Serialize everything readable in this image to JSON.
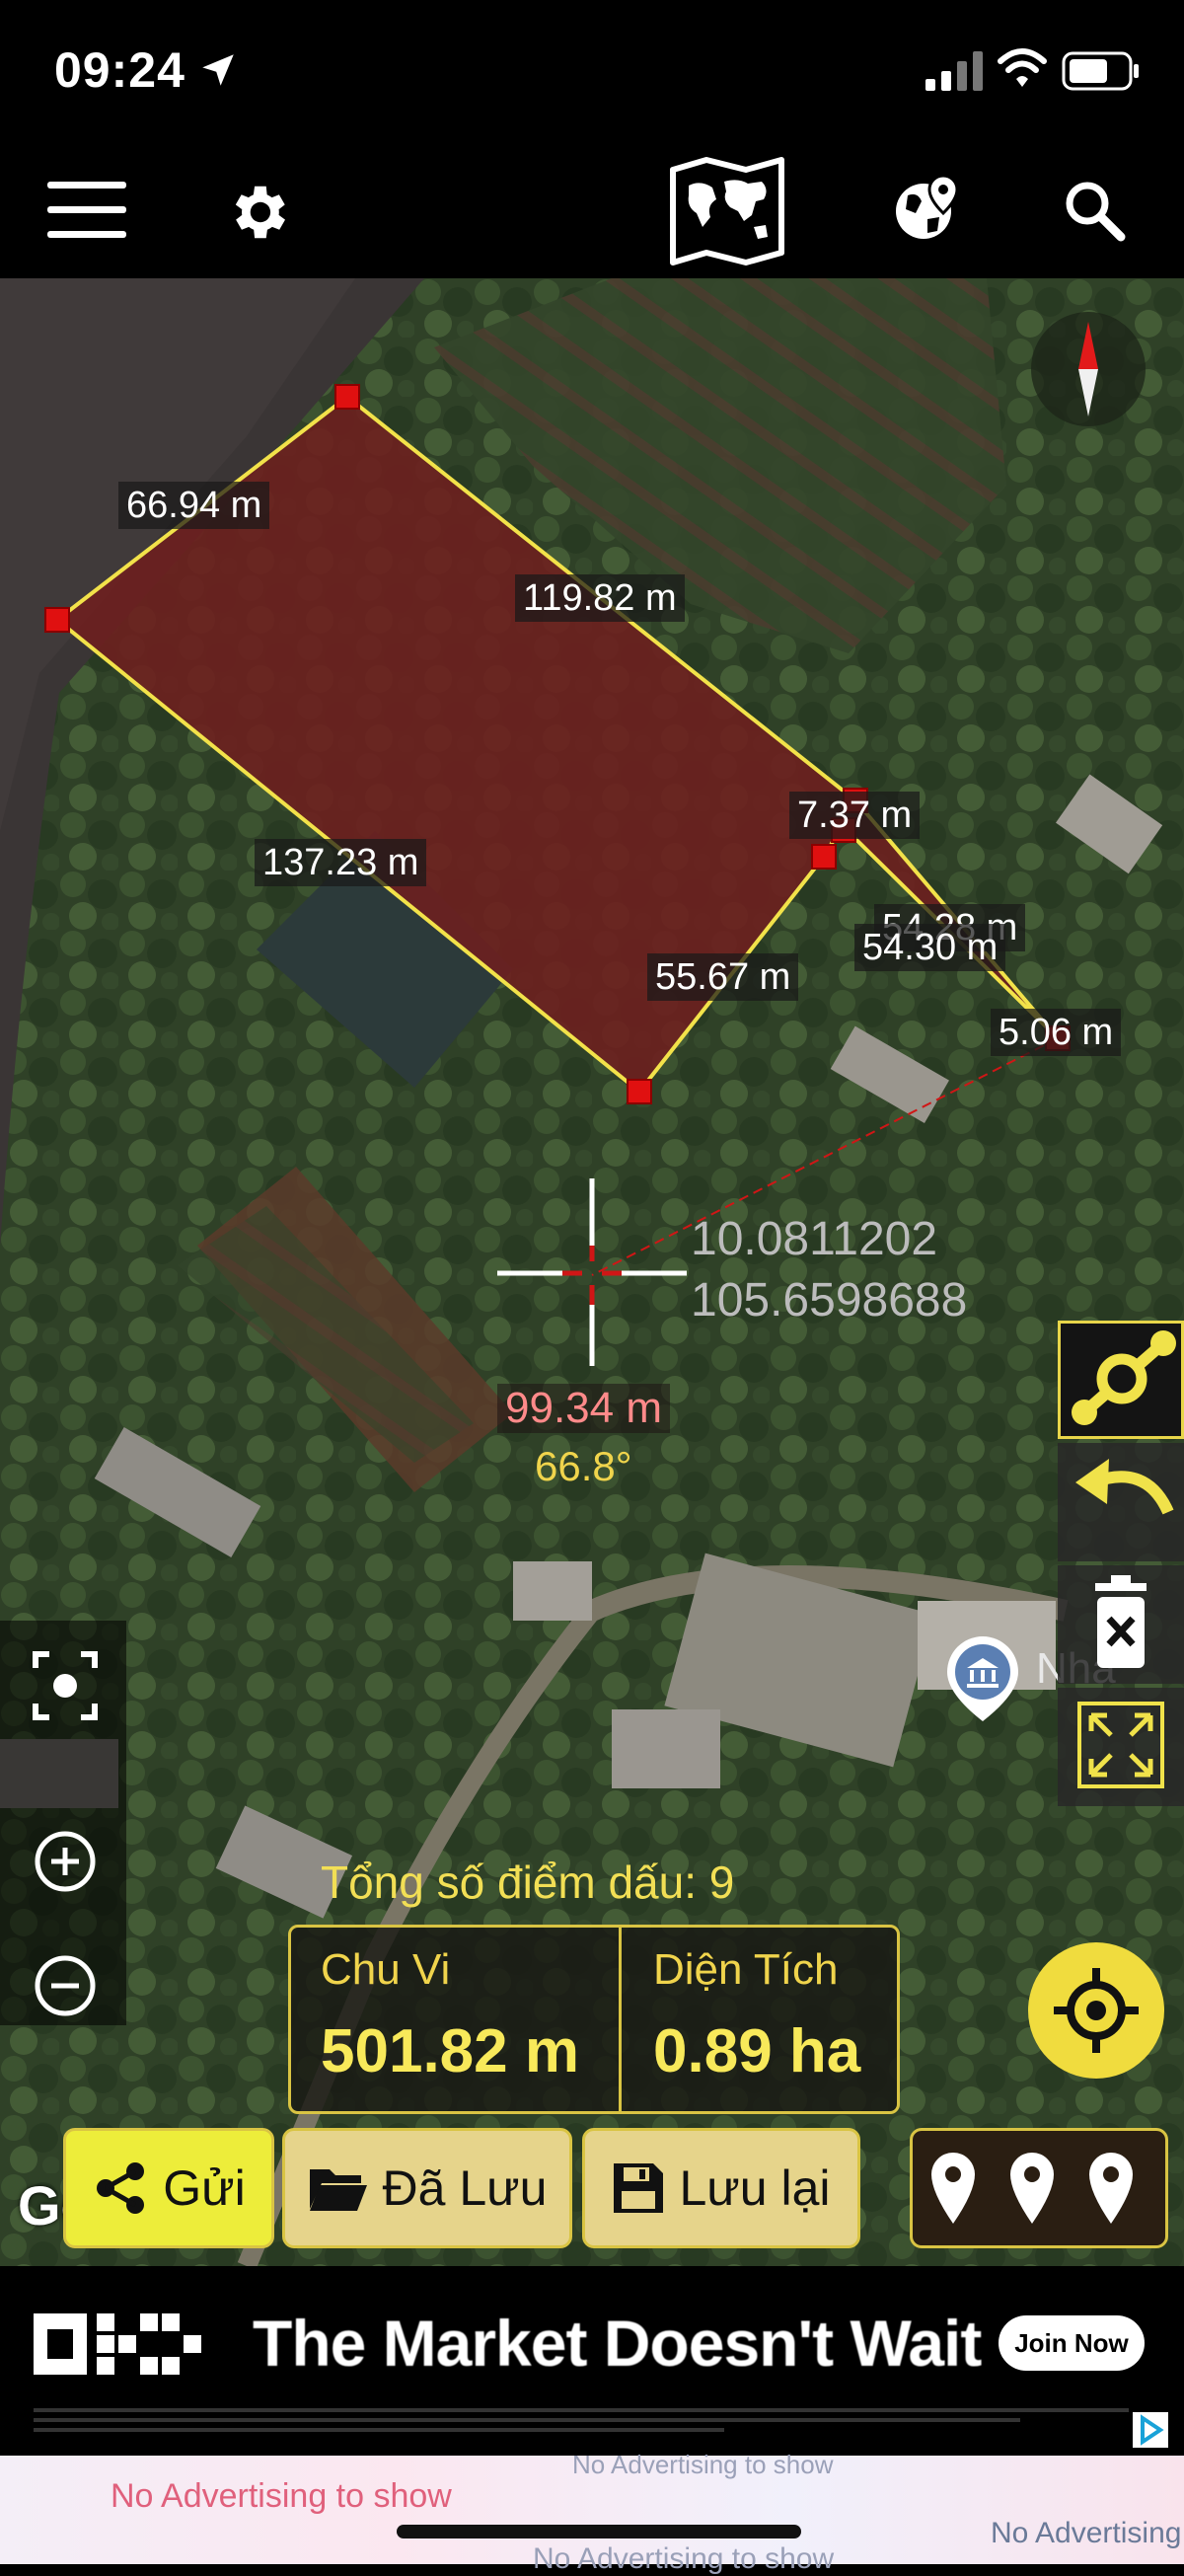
{
  "status": {
    "time": "09:24"
  },
  "toolbar": {
    "icons": [
      "menu-icon",
      "gear-icon",
      "world-map-icon",
      "globe-pin-icon",
      "search-icon"
    ]
  },
  "map": {
    "segments": [
      "66.94 m",
      "119.82 m",
      "137.23 m",
      "7.37 m",
      "54.28 m",
      "54.30 m",
      "55.67 m",
      "5.06 m"
    ],
    "crosshair": {
      "lat": "10.0811202",
      "lon": "105.6598688",
      "distance": "99.34 m",
      "bearing": "66.8°"
    },
    "place_label": "Nhà",
    "attribution": "Google",
    "polygon_color": "#6e1f1f",
    "vertex_color": "#e01010"
  },
  "info": {
    "point_count_label": "Tổng số điểm dấu: 9",
    "perimeter_label": "Chu Vi",
    "perimeter_value": "501.82 m",
    "area_label": "Diện Tích",
    "area_value": "0.89 ha"
  },
  "buttons": {
    "send": "Gửi",
    "saved": "Đã Lưu",
    "save": "Lưu lại"
  },
  "ad": {
    "headline": "The Market Doesn't Wait",
    "cta": "Join Now",
    "no_ads_1": "No Advertising to show",
    "no_ads_2": "No Advertising to show",
    "no_ads_3": "No Advertising to show",
    "no_ads_4": "No Advertising t"
  },
  "colors": {
    "accent": "#f0e24a",
    "button_bg": "#e6d48b",
    "send_bg": "#eded3a"
  }
}
